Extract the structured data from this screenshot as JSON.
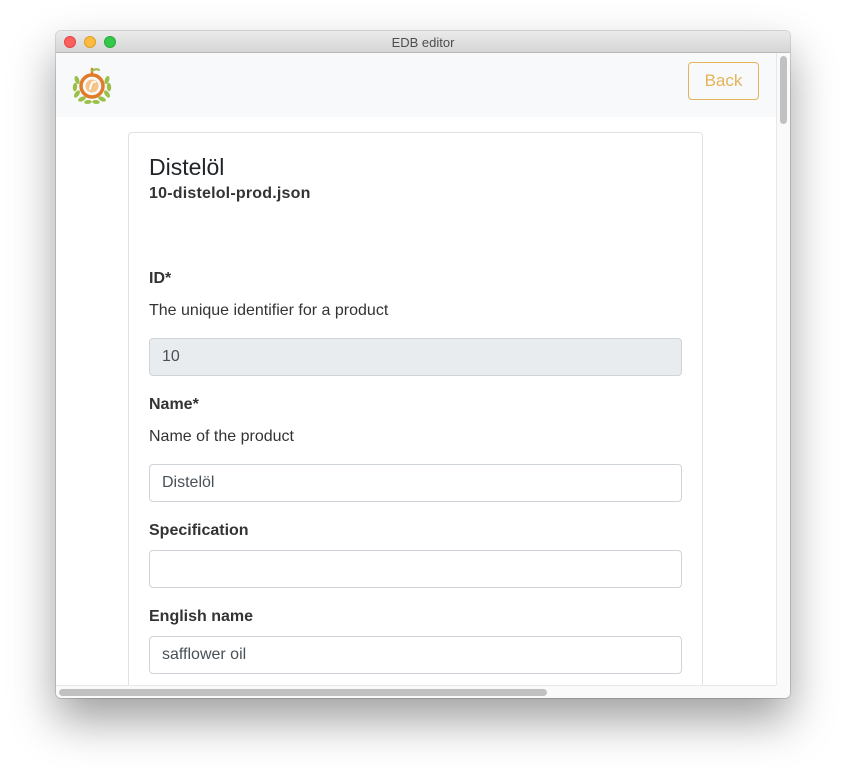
{
  "window": {
    "title": "EDB editor"
  },
  "navbar": {
    "logo_icon": "olive-wreath-logo-icon",
    "back_label": "Back"
  },
  "product": {
    "title": "Distelöl",
    "filename": "10-distelol-prod.json"
  },
  "fields": {
    "id": {
      "label": "ID*",
      "help": "The unique identifier for a product",
      "value": "10",
      "readonly": true
    },
    "name": {
      "label": "Name*",
      "help": "Name of the product",
      "value": "Distelöl"
    },
    "specification": {
      "label": "Specification",
      "value": ""
    },
    "english_name": {
      "label": "English name",
      "value": "safflower oil"
    }
  },
  "colors": {
    "accent": "#e3b45a",
    "navbar_bg": "#f8f9fa",
    "readonly_bg": "#e9ecef",
    "logo_orange": "#e07b2a",
    "logo_green": "#9bc04a"
  }
}
